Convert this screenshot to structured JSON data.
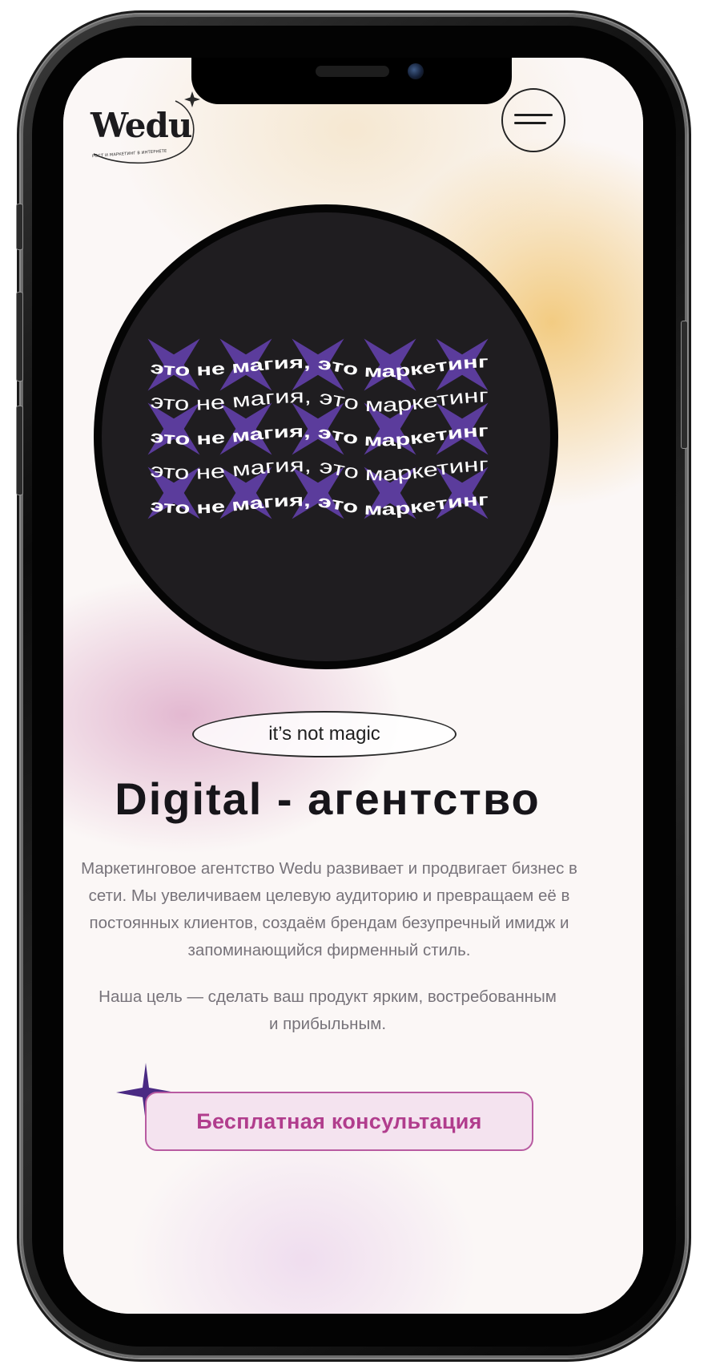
{
  "app": {
    "logo_text": "Wedu",
    "logo_tagline": "РОСТ И МАРКЕТИНГ В ИНТЕРНЕТЕ",
    "menu_icon": "hamburger-icon"
  },
  "hero": {
    "marquee_lines": [
      "это не магия, это маркетинг",
      "это не магия, это маркетинг",
      "это не магия, это маркетинг",
      "это не магия, это маркетинг",
      "это не магия, это маркетинг"
    ],
    "sparkle_color": "#5b3c9c",
    "circle_color": "#1f1d20"
  },
  "badge": {
    "label": "it’s not magic"
  },
  "main": {
    "title": "Digital - агентство",
    "description": "Маркетинговое агентство Wedu развивает и продвигает бизнес в сети. Мы увеличиваем целевую аудиторию и превращаем её в постоянных клиентов, создаём брендам безупречный имидж и запоминающийся фирменный стиль.",
    "goal": "Наша цель — сделать ваш продукт ярким, востребованным и прибыльным."
  },
  "cta": {
    "label": "Бесплатная консультация",
    "accent": "#b13d8d",
    "sparkle_color": "#4a2a83"
  }
}
